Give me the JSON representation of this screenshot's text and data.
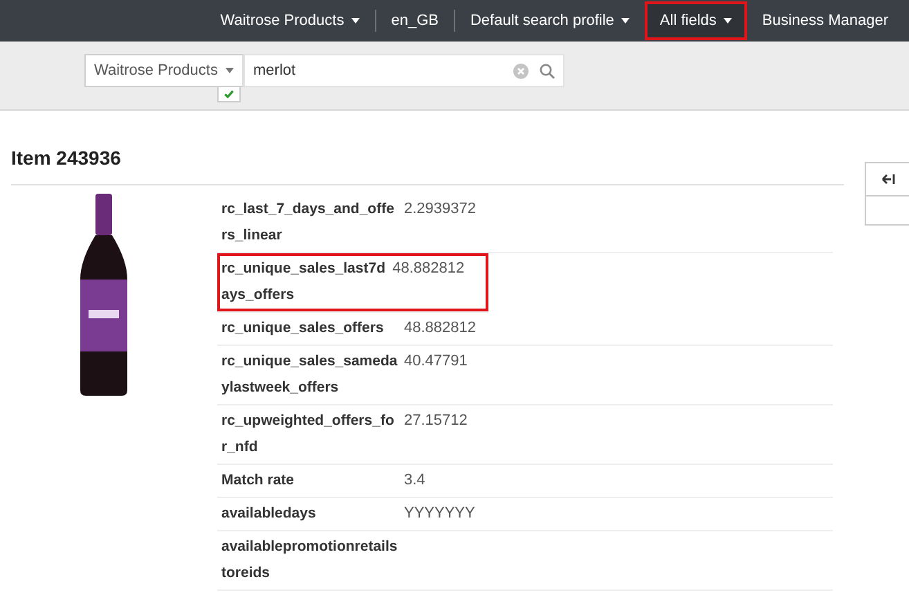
{
  "top_nav": [
    {
      "label": "Waitrose Products",
      "dropdown": true,
      "highlighted": false
    },
    {
      "label": "en_GB",
      "dropdown": false,
      "highlighted": false
    },
    {
      "label": "Default search profile",
      "dropdown": true,
      "highlighted": false
    },
    {
      "label": "All fields",
      "dropdown": true,
      "highlighted": true
    },
    {
      "label": "Business Manager",
      "dropdown": false,
      "highlighted": false
    }
  ],
  "search": {
    "scope": "Waitrose Products",
    "value": "merlot",
    "validated": true
  },
  "item": {
    "title": "Item 243936",
    "fields": [
      {
        "name": "rc_last_7_days_and_offers_linear",
        "value": "2.2939372",
        "highlighted": false
      },
      {
        "name": "rc_unique_sales_last7days_offers",
        "value": "48.882812",
        "highlighted": true
      },
      {
        "name": "rc_unique_sales_offers",
        "value": "48.882812",
        "highlighted": false
      },
      {
        "name": "rc_unique_sales_samedaylastweek_offers",
        "value": "40.47791",
        "highlighted": false
      },
      {
        "name": "rc_upweighted_offers_for_nfd",
        "value": "27.15712",
        "highlighted": false
      },
      {
        "name": "Match rate",
        "value": "3.4",
        "highlighted": false
      },
      {
        "name": "availabledays",
        "value": "YYYYYYY",
        "highlighted": false
      },
      {
        "name": "availablepromotionretailstoreids",
        "highlighted": false
      }
    ]
  }
}
